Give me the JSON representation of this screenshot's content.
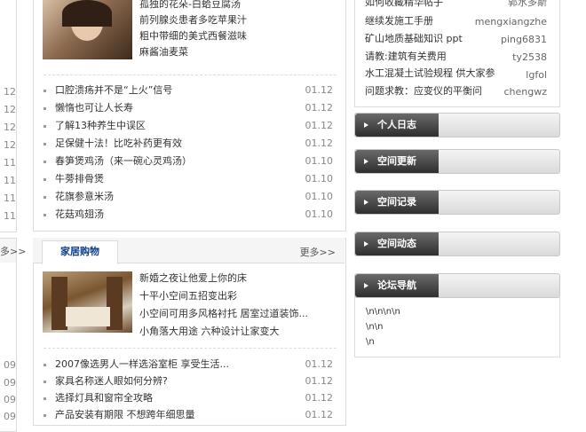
{
  "left_dates": {
    "top": [
      "12",
      "12",
      "12",
      "12",
      "11",
      "11",
      "11",
      "11"
    ],
    "bottom": [
      "09",
      "09",
      "09",
      "09"
    ]
  },
  "left_more": "多>>",
  "featured_top": [
    "孤独的花朵-白蛤豆腐汤",
    "前列腺炎患者多吃苹果汁",
    "粗中带细的美式西餐滋味",
    "麻酱油麦菜"
  ],
  "news_top": [
    {
      "title": "口腔溃疡并不是“上火”信号",
      "date": "01.12"
    },
    {
      "title": "懒惰也可让人长寿",
      "date": "01.12"
    },
    {
      "title": "了解13种养生中误区",
      "date": "01.12"
    },
    {
      "title": "足保健十法！比吃补药更有效",
      "date": "01.12"
    },
    {
      "title": "春笋煲鸡汤（来一碗心灵鸡汤）",
      "date": "01.10"
    },
    {
      "title": "牛蒡排骨煲",
      "date": "01.10"
    },
    {
      "title": "花旗参意米汤",
      "date": "01.10"
    },
    {
      "title": "花菇鸡翅汤",
      "date": "01.10"
    }
  ],
  "home_section": {
    "tab": "家居购物",
    "more": "更多>>"
  },
  "featured_home": [
    "新婚之夜让他爱上你的床",
    "十平小空间五招变出彩",
    "小空间可用多风格衬托 居室过道装饰...",
    "小角落大用途 六种设计让家变大"
  ],
  "news_home": [
    {
      "title": "2007像选男人一样选浴室柜 享受生活...",
      "date": "01.12"
    },
    {
      "title": "家具名称迷人眼如何分辨?",
      "date": "01.12"
    },
    {
      "title": "选择灯具和窗帘全攻略",
      "date": "01.12"
    },
    {
      "title": "产品安装有期限 不想跨年细思量",
      "date": "01.12"
    }
  ],
  "right_list": [
    {
      "title": "如何收藏精华帖子",
      "user": "郭水多斯"
    },
    {
      "title": "继续发施工手册",
      "user": "mengxiangzhe"
    },
    {
      "title": "矿山地质基础知识 ppt",
      "user": "ping6831"
    },
    {
      "title": "请教:建筑有关费用",
      "user": "ty2538"
    },
    {
      "title": "水工混凝土试验规程 供大家参",
      "user": "lgfol"
    },
    {
      "title": "问题求教：应变仪的平衡问",
      "user": "chengwz"
    }
  ],
  "sections": [
    "个人日志",
    "空间更新",
    "空间记录",
    "空间动态",
    "论坛导航"
  ],
  "forum_lines": [
    "\\n\\n\\n\\n",
    "\\n\\n",
    "\\n"
  ]
}
